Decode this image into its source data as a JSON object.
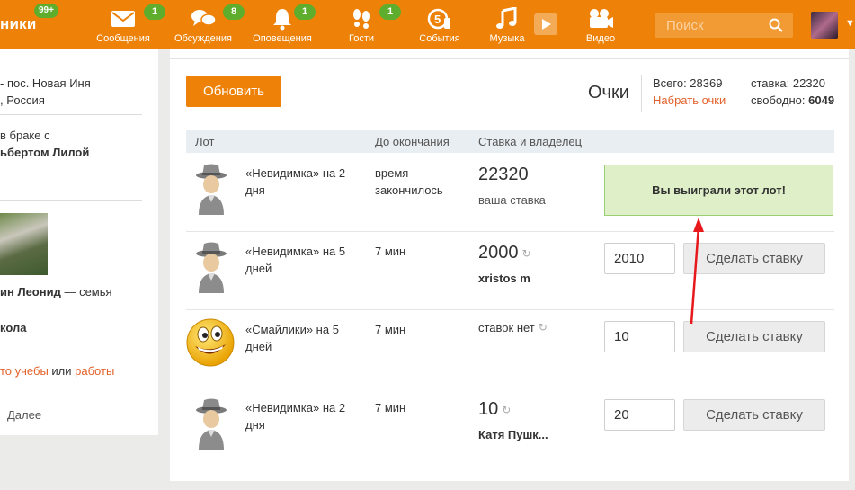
{
  "header": {
    "logo_text": "ники",
    "logo_badge": "99+",
    "nav": [
      {
        "label": "Сообщения",
        "badge": "1",
        "icon": "envelope-icon"
      },
      {
        "label": "Обсуждения",
        "badge": "8",
        "icon": "chat-bubbles-icon"
      },
      {
        "label": "Оповещения",
        "badge": "1",
        "icon": "bell-icon"
      },
      {
        "label": "Гости",
        "badge": "1",
        "icon": "footprints-icon"
      },
      {
        "label": "События",
        "badge": "",
        "icon": "five-hand-icon"
      },
      {
        "label": "Музыка",
        "badge": "",
        "icon": "music-note-icon"
      },
      {
        "label": "Видео",
        "badge": "",
        "icon": "video-camera-icon"
      }
    ],
    "search_placeholder": "Поиск"
  },
  "left": {
    "location_line1": "- пос. Новая Иня",
    "location_line2": ", Россия",
    "marriage_line1": "в браке с",
    "marriage_line2": "ьбертом Лилой",
    "family_name": "ин Леонид",
    "family_suffix": " — семья",
    "school": "кола",
    "study_prefix": "то учебы",
    "study_or": " или ",
    "study_work": "работы",
    "more": "Далее"
  },
  "main": {
    "refresh_button": "Обновить",
    "points_title": "Очки",
    "total_label": "Всего: 28369",
    "collect_points": "Набрать очки",
    "stake_label": "ставка: 22320",
    "free_label": "свободно:",
    "free_value": "6049",
    "columns": {
      "lot": "Лот",
      "ends": "До окончания",
      "bid_owner": "Ставка и владелец"
    },
    "rows": [
      {
        "lot": "«Невидимка» на 2 дня",
        "time": "время закончилось",
        "bid": "22320",
        "owner": "ваша ставка",
        "won_text": "Вы выиграли этот лот!"
      },
      {
        "lot": "«Невидимка» на 5 дней",
        "time": "7 мин",
        "bid": "2000",
        "owner": "xristos m",
        "input": "2010",
        "button": "Сделать ставку"
      },
      {
        "lot": "«Смайлики» на 5 дней",
        "time": "7 мин",
        "bid": "ставок нет",
        "owner": "",
        "input": "10",
        "button": "Сделать ставку"
      },
      {
        "lot": "«Невидимка» на 2 дня",
        "time": "7 мин",
        "bid": "10",
        "owner": "Катя Пушк...",
        "input": "20",
        "button": "Сделать ставку"
      }
    ]
  },
  "colors": {
    "brand": "#ee8208",
    "badge": "#5fad2c",
    "link": "#e2612a",
    "won_bg": "#dff0c9"
  }
}
